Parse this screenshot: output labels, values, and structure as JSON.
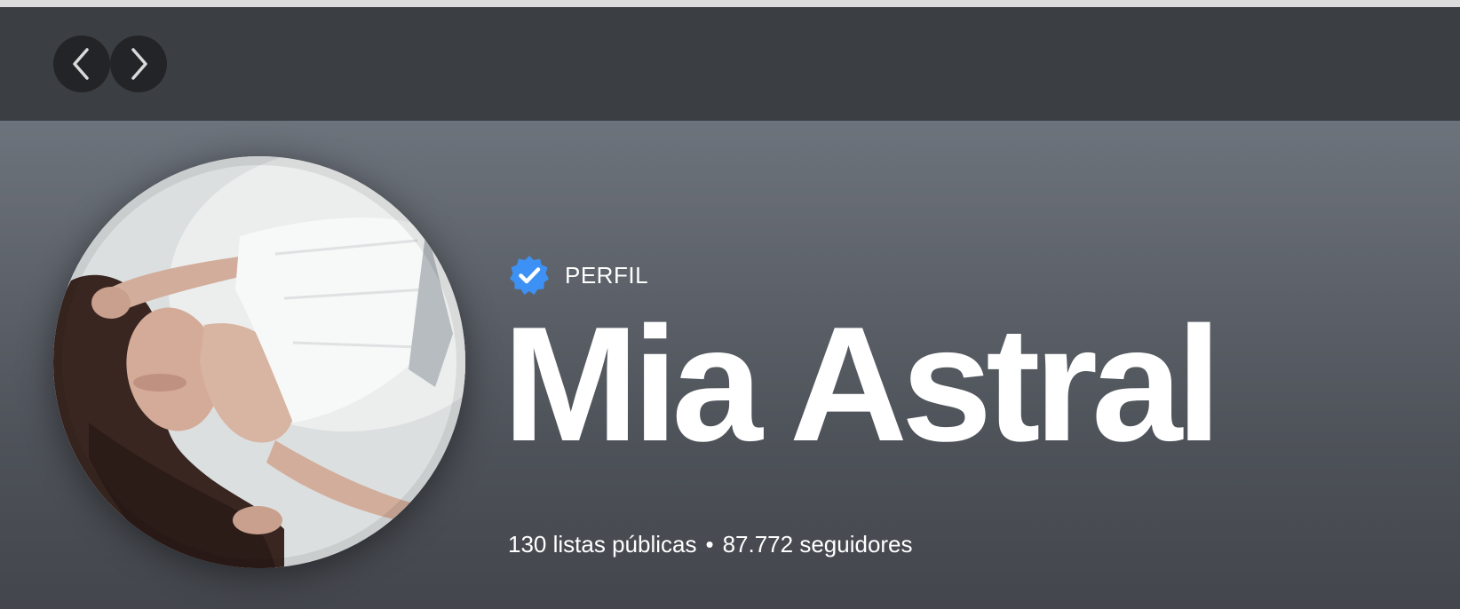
{
  "navigation": {
    "back_icon": "chevron-left-icon",
    "forward_icon": "chevron-right-icon"
  },
  "profile": {
    "verified_icon": "verified-badge-icon",
    "type_label": "PERFIL",
    "name": "Mia Astral",
    "public_playlists": "130 listas públicas",
    "separator": "•",
    "followers": "87.772 seguidores"
  },
  "colors": {
    "verified_blue": "#3d91f4",
    "text": "#ffffff",
    "nav_button_bg": "#232427"
  }
}
